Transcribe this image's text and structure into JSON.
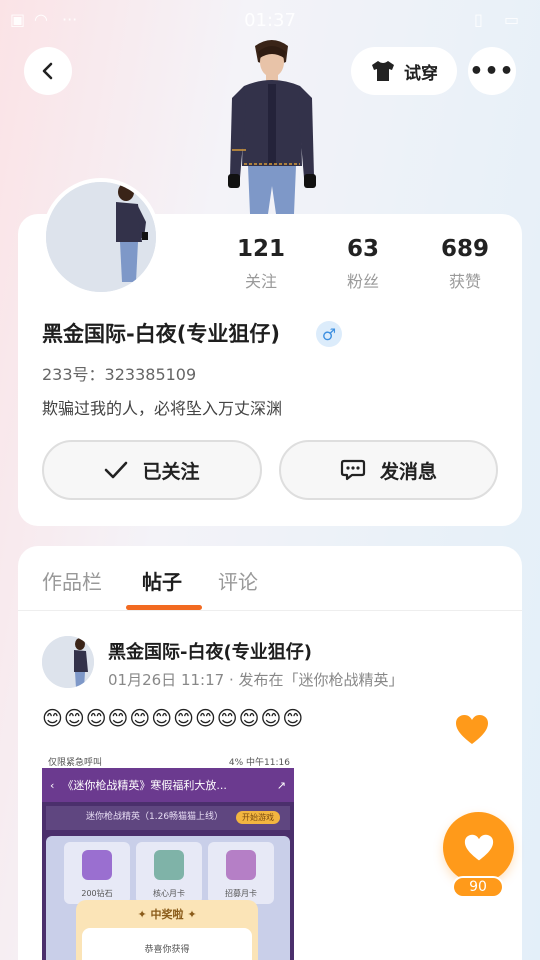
{
  "status_bar": {
    "time": "01:37"
  },
  "header": {
    "try_on_label": "试穿",
    "more_label": "•••"
  },
  "profile": {
    "stats": [
      {
        "value": "121",
        "label": "关注"
      },
      {
        "value": "63",
        "label": "粉丝"
      },
      {
        "value": "689",
        "label": "获赞"
      }
    ],
    "nickname": "黑金国际-白夜(专业狙仔)",
    "gender_symbol": "♂",
    "uid": "233号：323385109",
    "bio": "欺骗过我的人，必将坠入万丈深渊",
    "follow_label": "已关注",
    "message_label": "发消息"
  },
  "tabs": [
    {
      "label": "作品栏"
    },
    {
      "label": "帖子"
    },
    {
      "label": "评论"
    }
  ],
  "active_tab": "帖子",
  "post": {
    "author": "黑金国际-白夜(专业狙仔)",
    "meta": "01月26日 11:17 · 发布在「迷你枪战精英」",
    "emojis": "😊😊😊😊😊😊😊😊😊😊😊😊",
    "image": {
      "status_left": "仅限紧急呼叫",
      "status_right": "4% 中午11:16",
      "nav_title": "《迷你枪战精英》寒假福利大放...",
      "banner_text": "迷你枪战精英（1.26畅猫猫上线）",
      "banner_button": "开始游戏",
      "items": [
        "200钻石",
        "核心月卡",
        "招募月卡"
      ],
      "popup_title": "✦ 中奖啦 ✦",
      "popup_text": "恭喜你获得"
    },
    "like_count": "90"
  },
  "colors": {
    "accent": "#f26a21",
    "like": "#ff9a1a",
    "gender": "#3d8fe0"
  }
}
